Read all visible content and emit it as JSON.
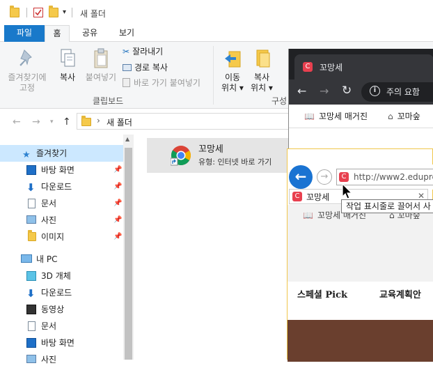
{
  "window": {
    "title": "새 폴더",
    "qat_dropdown": "▾"
  },
  "ribbon": {
    "tabs": [
      "파일",
      "홈",
      "공유",
      "보기"
    ],
    "clipboard": {
      "pin": "즐겨찾기에\n고정",
      "copy": "복사",
      "paste": "붙여넣기",
      "cut": "잘라내기",
      "copy_path": "경로 복사",
      "paste_shortcut": "바로 가기 붙여넣기",
      "group_label": "클립보드"
    },
    "organize": {
      "move_to": "이동\n위치 ▾",
      "copy_to": "복사\n위치 ▾",
      "group_label": "구성"
    }
  },
  "address": {
    "path": "새 폴더",
    "sep": "›"
  },
  "nav": {
    "quick_access": "즐겨찾기",
    "items": [
      "바탕 화면",
      "다운로드",
      "문서",
      "사진",
      "이미지"
    ],
    "pc": "내 PC",
    "pc_items": [
      "3D 개체",
      "다운로드",
      "동영상",
      "문서",
      "바탕 화면",
      "사진"
    ]
  },
  "file": {
    "name": "꼬망세",
    "type": "유형: 인터넷 바로 가기"
  },
  "chrome": {
    "tab_title": "꼬망세",
    "notice": "주의 요함",
    "bookmarks": [
      "꼬망세 매거진",
      "꼬마숲"
    ]
  },
  "ie": {
    "url": "http://www2.edupre.",
    "tab_title": "꼬망세",
    "bookmarks": [
      "꼬망세 매거진",
      "꼬마숲"
    ],
    "page_labels": [
      "스페셜 Pick",
      "교육계획안"
    ]
  },
  "tooltip": {
    "text": "작업 표시줄로 끌어서 사"
  },
  "colors": {
    "file_tab": "#1979ca",
    "selected_nav": "#cce8ff",
    "chrome_dark": "#202124",
    "ie_back": "#1a73d2",
    "brand_red": "#e8404f"
  }
}
